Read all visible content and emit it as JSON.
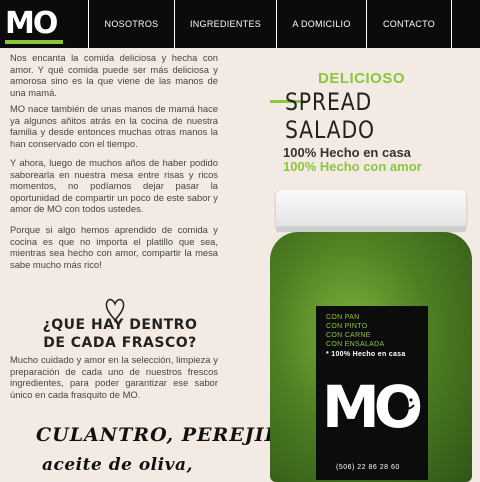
{
  "nav": {
    "logo": "MO",
    "items": [
      {
        "label": "NOSOTROS"
      },
      {
        "label": "INGREDIENTES"
      },
      {
        "label": "A DOMICILIO"
      },
      {
        "label": "CONTACTO"
      }
    ]
  },
  "left": {
    "paragraphs": [
      "Nos encanta la comida deliciosa y hecha con amor. Y qué comida puede ser más deliciosa y amorosa sino es la que viene de las manos de una mamá.",
      "MO nace también de unas manos de mamá hace ya algunos añitos atrás en la cocina de nuestra familia y desde entonces muchas otras manos la han conservado con el tiempo.",
      "Y ahora, luego de muchos años de haber podido saborearla en nuestra mesa entre risas y ricos momentos, no podíamos dejar pasar la oportunidad de compartir un poco de este sabor y amor de MO con todos ustedes.",
      "Porque si algo hemos aprendido de comida y cocina es que no importa el platillo que sea, mientras sea hecho con amor, compartir la mesa sabe mucho más rico!"
    ],
    "question": "¿QUE HAY DENTRO DE CADA FRASCO?",
    "answer": "Mucho cuidado y amor en la selección, limpieza y preparación de cada uno de nuestros frescos ingredientes, para poder garantizar ese sabor único en cada frasquito de MO.",
    "hand1": "CULANTRO, PEREJIL,",
    "hand2": "aceite de oliva,"
  },
  "right": {
    "delicioso": "DELICIOSO",
    "spread": "SPREAD SALADO",
    "tag1": "100% Hecho en casa",
    "tag2": "100% Hecho con amor"
  },
  "jar": {
    "label_lines": [
      "CON PAN",
      "CON PINTO",
      "CON CARNE",
      "CON ENSALADA"
    ],
    "label_tag": "* 100% Hecho en casa",
    "logo": "MO",
    "phone": "(506) 22 86 28 60"
  },
  "colors": {
    "accent": "#8cc63f",
    "nav_bg": "#0b0b0b",
    "page_bg": "#f3ebe3"
  }
}
